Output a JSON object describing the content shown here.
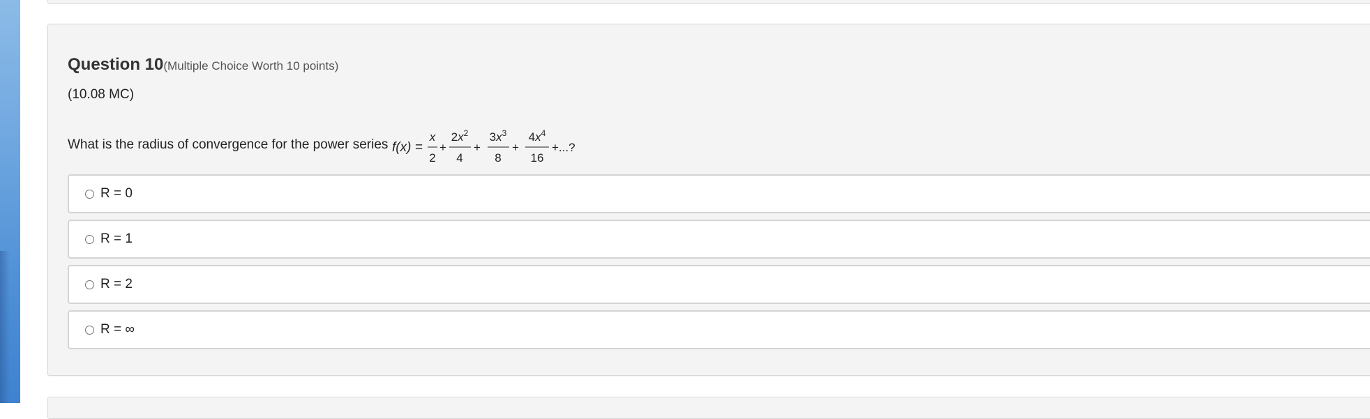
{
  "question": {
    "title": "Question 10",
    "worth": "(Multiple Choice Worth 10 points)",
    "code": "(10.08 MC)",
    "prompt": "What is the radius of convergence for the power series",
    "formula": {
      "lhs": "f(x) =",
      "terms": [
        {
          "numerator_coef": "",
          "numerator_var": "x",
          "numerator_exp": "",
          "denominator": "2"
        },
        {
          "numerator_coef": "2",
          "numerator_var": "x",
          "numerator_exp": "2",
          "denominator": "4"
        },
        {
          "numerator_coef": "3",
          "numerator_var": "x",
          "numerator_exp": "3",
          "denominator": "8"
        },
        {
          "numerator_coef": "4",
          "numerator_var": "x",
          "numerator_exp": "4",
          "denominator": "16"
        }
      ],
      "operator": "+",
      "tail": "+...?"
    },
    "options": [
      {
        "label": "R = 0",
        "selected": false
      },
      {
        "label": "R = 1",
        "selected": false
      },
      {
        "label": "R = 2",
        "selected": false
      },
      {
        "label": "R = ∞",
        "selected": false
      }
    ]
  },
  "colors": {
    "card_background": "#f4f4f4",
    "card_border": "#d6d6d6",
    "option_border": "#d4d4d4",
    "side_strip": "#5e9cdc"
  }
}
